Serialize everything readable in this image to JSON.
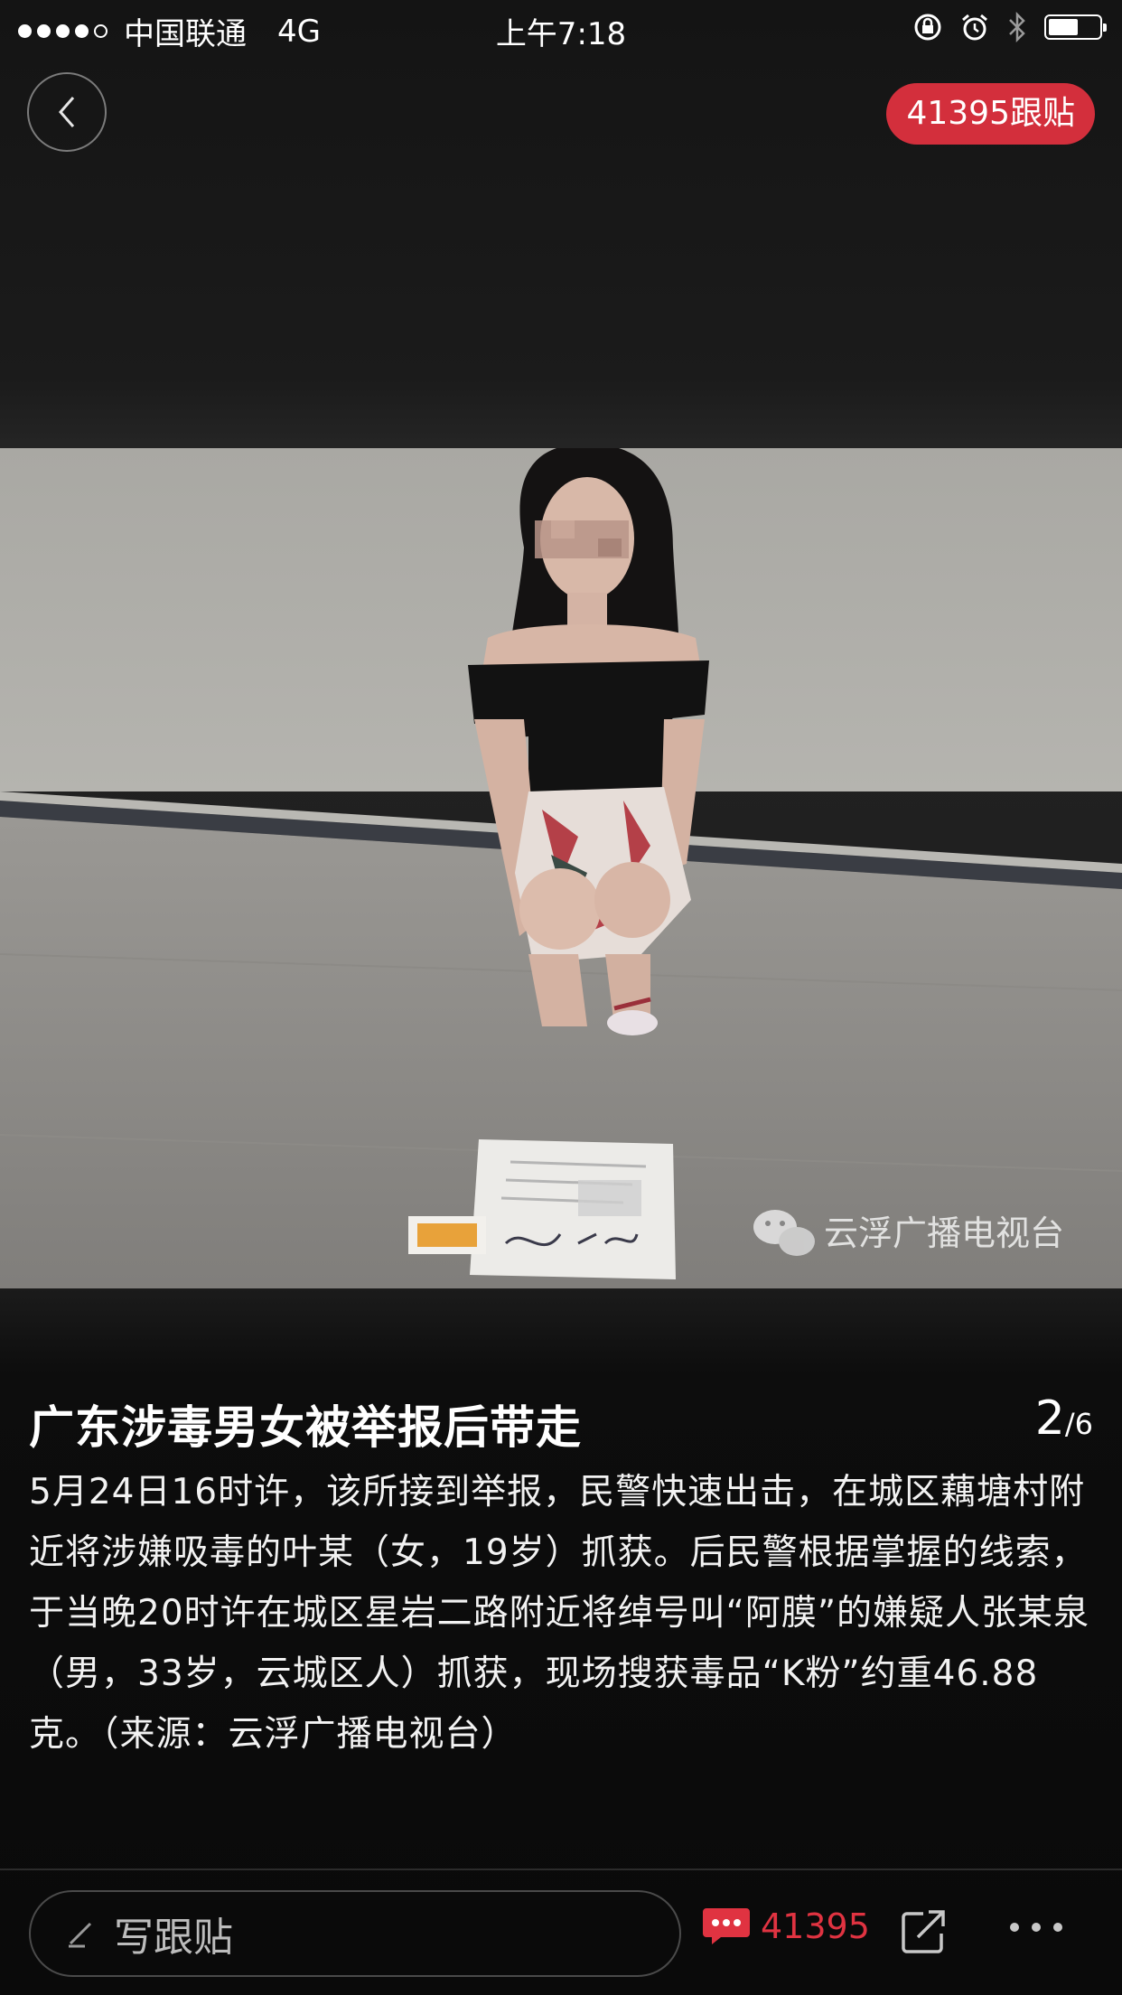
{
  "status_bar": {
    "carrier": "中国联通",
    "network": "4G",
    "time": "上午7:18",
    "battery_level": 0.6
  },
  "nav": {
    "comment_badge": "41395跟贴"
  },
  "photo": {
    "watermark": "云浮广播电视台"
  },
  "article": {
    "title": "广东涉毒男女被举报后带走",
    "page_current": "2",
    "page_total": "/6",
    "body": "5月24日16时许，该所接到举报，民警快速出击，在城区藕塘村附近将涉嫌吸毒的叶某（女，19岁）抓获。后民警根据掌握的线索，于当晚20时许在城区星岩二路附近将绰号叫“阿膜”的嫌疑人张某泉（男，33岁，云城区人）抓获，现场搜获毒品“K粉”约重46.88克。（来源：云浮广播电视台）"
  },
  "bottom_bar": {
    "reply_placeholder": "写跟贴",
    "comment_count": "41395"
  },
  "colors": {
    "accent_red": "#d32f3c",
    "background": "#141414"
  }
}
